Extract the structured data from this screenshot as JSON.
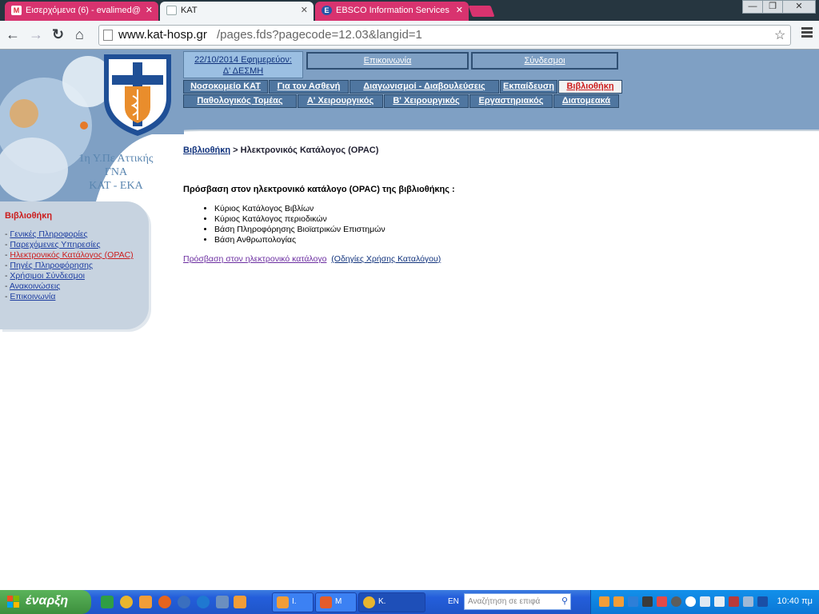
{
  "browser": {
    "tabs": [
      {
        "title": "Εισερχόμενα (6) - evalimed@",
        "icon": "gmail-icon"
      },
      {
        "title": "ΚΑΤ",
        "icon": "page-icon"
      },
      {
        "title": "EBSCO Information Services",
        "icon": "ebsco-icon"
      }
    ],
    "close_glyph": "✕",
    "url_host": "www.kat-hosp.gr",
    "url_path": "/pages.fds?pagecode=12.03&langid=1"
  },
  "header": {
    "brand_lines": [
      "1η Υ.Πε Αττικής",
      "ΓΝΑ",
      "ΚΑΤ - ΕΚΑ"
    ],
    "duty": {
      "line1": "22/10/2014 Εφημερεύον:",
      "line2": "Δ' ΔΕΣΜΗ"
    },
    "top_buttons": [
      "Επικοινωνία",
      "Σύνδεσμοι"
    ],
    "nav_row1": [
      "Νοσοκομείο ΚΑΤ",
      "Για τον Ασθενή",
      "Διαγωνισμοί - Διαβουλεύσεις",
      "Εκπαίδευση",
      "Βιβλιοθήκη"
    ],
    "nav_row2": [
      "Παθολογικός Τομέας",
      "Α' Χειρουργικός",
      "Β' Χειρουργικός",
      "Εργαστηριακός",
      "Διατομεακά"
    ]
  },
  "sidebar": {
    "title": "Βιβλιοθήκη",
    "items": [
      "Γενικές Πληροφορίες",
      "Παρεχόμενες Υπηρεσίες",
      "Ηλεκτρονικός Κατάλογος (OPAC)",
      "Πηγές Πληροφόρησης",
      "Χρήσιμοι Σύνδεσμοι",
      "Ανακοινώσεις",
      "Επικοινωνία"
    ],
    "prefix": "- "
  },
  "content": {
    "breadcrumb_link": "Βιβλιοθήκη",
    "breadcrumb_sep": " > ",
    "breadcrumb_current": "Ηλεκτρονικός Κατάλογος (OPAC)",
    "heading": "Πρόσβαση στον ηλεκτρονικό κατάλογο (OPAC) της βιβλιοθήκης :",
    "items": [
      "Κύριος Κατάλογος Βιβλίων",
      "Κύριος Κατάλογος περιοδικών",
      "Βάση Πληροφόρησης Βιοϊατρικών Επιστημών",
      "Βάση Ανθρωπολογίας"
    ],
    "access_link": "Πρόσβαση στον ηλεκτρονικό κατάλογο",
    "guide_link": "(Οδηγίες Χρήσης Καταλόγου)"
  },
  "taskbar": {
    "start_label": "έναρξη",
    "tasks": [
      "I.",
      "M",
      "K."
    ],
    "lang": "EN",
    "search_placeholder": "Αναζήτηση σε επιφά",
    "clock": "10:40 πμ"
  },
  "colors": {
    "header": "#7fa0c4",
    "nav_button": "#4f76a0",
    "active_red": "#cc1d1d",
    "link_blue": "#10327c"
  }
}
